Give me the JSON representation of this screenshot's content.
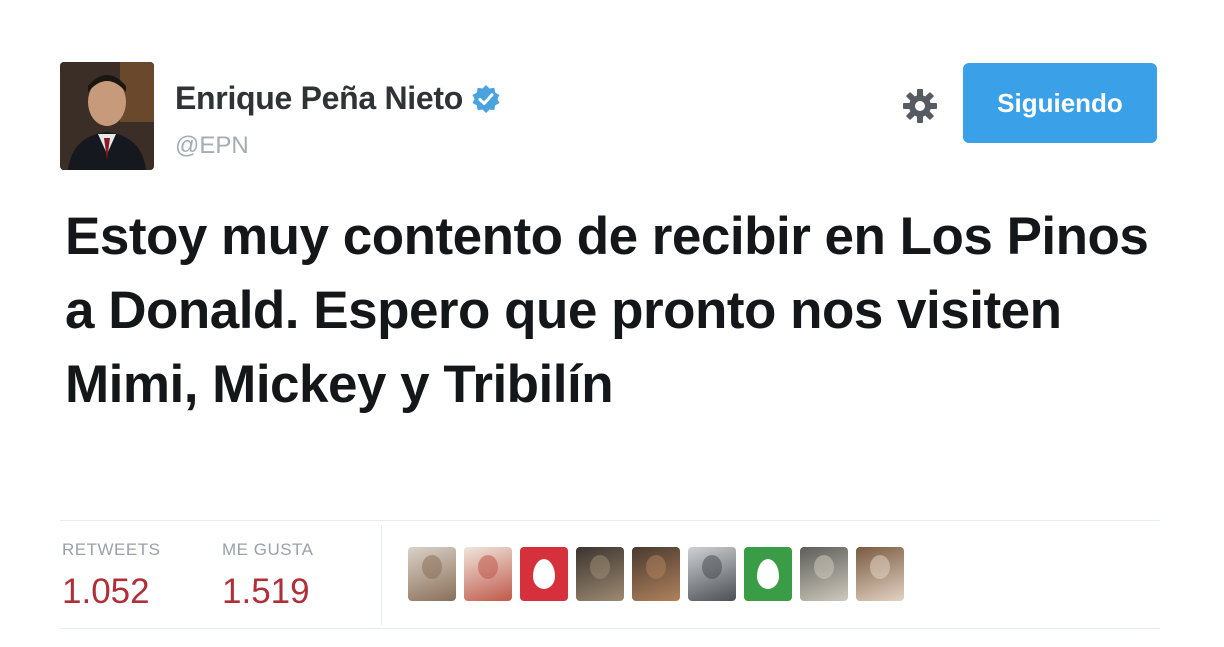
{
  "user": {
    "display_name": "Enrique Peña Nieto",
    "handle": "@EPN",
    "verified": true,
    "avatar_icon": "profile-photo"
  },
  "actions": {
    "follow_label": "Siguiendo",
    "settings_icon": "gear-icon"
  },
  "tweet": {
    "text": "Estoy muy contento de recibir en Los Pinos a Donald. Espero que pronto nos visiten Mimi, Mickey y Tribilín"
  },
  "stats": {
    "retweets_label": "RETWEETS",
    "retweets_value": "1.052",
    "likes_label": "ME GUSTA",
    "likes_value": "1.519"
  },
  "likers": [
    {
      "kind": "photo",
      "colors": [
        "#d9d2c8",
        "#8a6f5a"
      ]
    },
    {
      "kind": "photo",
      "colors": [
        "#efe6dc",
        "#c0584a"
      ]
    },
    {
      "kind": "egg",
      "colors": [
        "#d6303c"
      ]
    },
    {
      "kind": "photo",
      "colors": [
        "#3b342e",
        "#9d8a72"
      ]
    },
    {
      "kind": "photo",
      "colors": [
        "#4a3a30",
        "#b0825c"
      ]
    },
    {
      "kind": "photo",
      "colors": [
        "#cfd2d4",
        "#4a4f54"
      ]
    },
    {
      "kind": "egg",
      "colors": [
        "#3a9c45"
      ]
    },
    {
      "kind": "photo",
      "colors": [
        "#5c5e58",
        "#cfc9bd"
      ]
    },
    {
      "kind": "photo",
      "colors": [
        "#7a5a42",
        "#e2d3c2"
      ]
    }
  ],
  "colors": {
    "accent": "#3aa0e8",
    "stat_value": "#b0303a",
    "verified": "#4aa3df"
  }
}
